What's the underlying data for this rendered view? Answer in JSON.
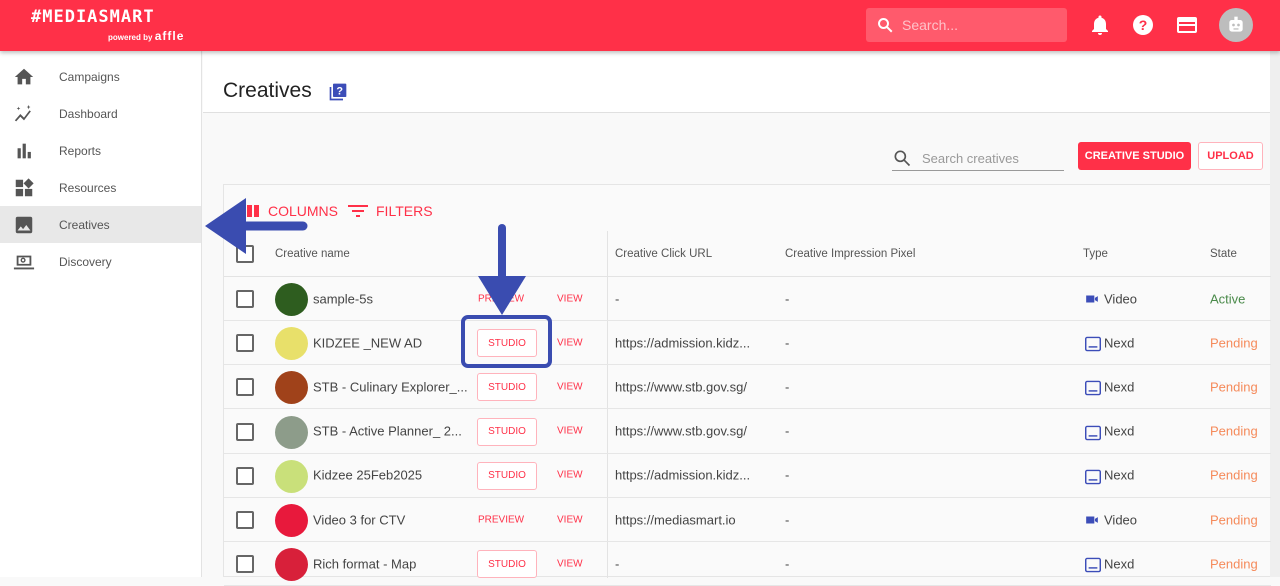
{
  "header": {
    "logo": "#MEDIASMART",
    "powered_by": "powered by",
    "brand": "affle",
    "search_placeholder": "Search..."
  },
  "sidebar": {
    "items": [
      {
        "label": "Campaigns",
        "icon": "home-icon"
      },
      {
        "label": "Dashboard",
        "icon": "dashboard-icon"
      },
      {
        "label": "Reports",
        "icon": "bar-chart-icon"
      },
      {
        "label": "Resources",
        "icon": "widgets-icon"
      },
      {
        "label": "Creatives",
        "icon": "image-icon",
        "active": true
      },
      {
        "label": "Discovery",
        "icon": "laptop-search-icon"
      }
    ]
  },
  "page": {
    "title": "Creatives",
    "search_placeholder": "Search creatives",
    "creative_studio": "CREATIVE STUDIO",
    "upload": "UPLOAD",
    "columns": "COLUMNS",
    "filters": "FILTERS"
  },
  "table": {
    "headers": {
      "name": "Creative name",
      "click_url": "Creative Click URL",
      "pixel": "Creative Impression Pixel",
      "type": "Type",
      "state": "State"
    },
    "rows": [
      {
        "name": "sample-5s",
        "action": "PREVIEW",
        "view": "VIEW",
        "url": "-",
        "pixel": "-",
        "type": "Video",
        "state": "Active",
        "thumb": "#2e5d1f"
      },
      {
        "name": "KIDZEE _NEW AD",
        "action": "STUDIO",
        "view": "VIEW",
        "url": "https://admission.kidz...",
        "pixel": "-",
        "type": "Nexd",
        "state": "Pending",
        "thumb": "#e8e06a"
      },
      {
        "name": "STB - Culinary Explorer_...",
        "action": "STUDIO",
        "view": "VIEW",
        "url": "https://www.stb.gov.sg/",
        "pixel": "-",
        "type": "Nexd",
        "state": "Pending",
        "thumb": "#a0421a"
      },
      {
        "name": "STB - Active Planner_ 2...",
        "action": "STUDIO",
        "view": "VIEW",
        "url": "https://www.stb.gov.sg/",
        "pixel": "-",
        "type": "Nexd",
        "state": "Pending",
        "thumb": "#8d9c8a"
      },
      {
        "name": "Kidzee 25Feb2025",
        "action": "STUDIO",
        "view": "VIEW",
        "url": "https://admission.kidz...",
        "pixel": "-",
        "type": "Nexd",
        "state": "Pending",
        "thumb": "#c9e07a"
      },
      {
        "name": "Video 3 for CTV",
        "action": "PREVIEW",
        "view": "VIEW",
        "url": "https://mediasmart.io",
        "pixel": "-",
        "type": "Video",
        "state": "Pending",
        "thumb": "#e8193c"
      },
      {
        "name": "Rich format - Map",
        "action": "STUDIO",
        "view": "VIEW",
        "url": "-",
        "pixel": "-",
        "type": "Nexd",
        "state": "Pending",
        "thumb": "#d8203a"
      }
    ]
  },
  "colors": {
    "brand": "#ff3048",
    "active": "#4a8a4a",
    "pending": "#f58a5a",
    "icon_blue": "#3c4db8",
    "annotation": "#3a4cb0"
  }
}
